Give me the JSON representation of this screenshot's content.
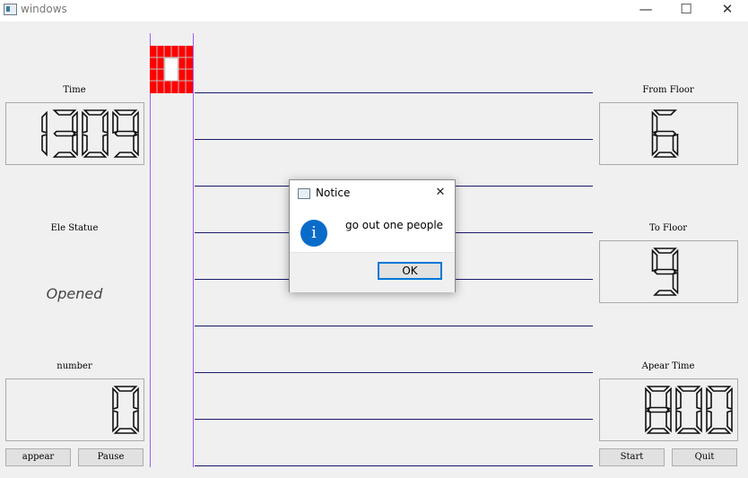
{
  "window": {
    "title": "windows",
    "controls": {
      "minimize": "—",
      "maximize": "☐",
      "close": "✕"
    }
  },
  "left": {
    "time_label": "Time",
    "time_value": "1309",
    "status_label": "Ele Statue",
    "status_value": "Opened",
    "number_label": "number",
    "number_value": "0",
    "appear_button": "appear",
    "pause_button": "Pause"
  },
  "right": {
    "from_label": "From Floor",
    "from_value": "6",
    "to_label": "To Floor",
    "to_value": "9",
    "appear_time_label": "Apear Time",
    "appear_time_value": "800",
    "start_button": "Start",
    "quit_button": "Quit"
  },
  "dialog": {
    "title": "Notice",
    "message": "go out one people",
    "ok_label": "OK",
    "close": "✕",
    "info_icon": "i"
  },
  "colors": {
    "elevator": "#ff0000",
    "floor_line": "#1c1a6a",
    "shaft_line": "#a060f0",
    "info": "#0a6cc9"
  }
}
